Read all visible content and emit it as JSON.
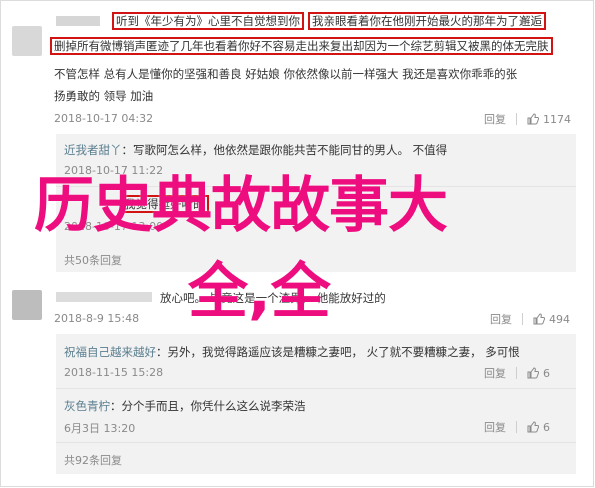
{
  "comment1": {
    "line1_plain": "听到《年少有为》心里不自觉想到你",
    "line1_boxed": "我亲眼看着你在他刚开始最火的那年为了邂逅",
    "line2_boxed": "删掉所有微博销声匿迹了几年也看着你好不容易走出来复出却因为一个综艺剪辑又被黑的体无完肤",
    "line3": "不管怎样  总有人是懂你的坚强和善良  好姑娘  你依然像以前一样强大  我还是喜欢你乖乖的张",
    "line4": "扬勇敢的  领导  加油",
    "timestamp": "2018-10-17 04:32",
    "reply_label": "回复",
    "like_count": "1174"
  },
  "replies1": [
    {
      "user": "近我者甜丫",
      "text": "：写歌阿怎么样，他依然是跟你能共苦不能同甘的男人。  不值得",
      "timestamp": "2018-10-17 11:22"
    },
    {
      "user": "",
      "text": "我觉得挺好听的",
      "timestamp": "2018-10-17 13:00"
    }
  ],
  "replies1_more": "共50条回复",
  "comment2": {
    "text": "放心吧。  毕竟这是一个渣男，  他能放好过的",
    "timestamp": "2018-8-9 15:48",
    "reply_label": "回复",
    "like_count": "494"
  },
  "replies2": [
    {
      "user": "祝福自己越来越好",
      "text": "：另外，我觉得路遥应该是糟糠之妻吧，  火了就不要糟糠之妻，  多可恨",
      "timestamp": "2018-11-15 15:28",
      "reply_label": "回复",
      "like_count": "6"
    },
    {
      "user": "灰色青柠",
      "text": "：分个手而且，你凭什么这么说李荣浩",
      "timestamp": "6月3日 13:20",
      "reply_label": "回复",
      "like_count": "6"
    }
  ],
  "replies2_more": "共92条回复",
  "watermark": {
    "line1": "历史典故故事大",
    "line2": "全,全"
  },
  "colors": {
    "highlight_box": "#d11313",
    "watermark": "#ee0d7f",
    "username": "#5a7e8f"
  },
  "icons": [
    "thumbs-up-icon",
    "avatar"
  ]
}
